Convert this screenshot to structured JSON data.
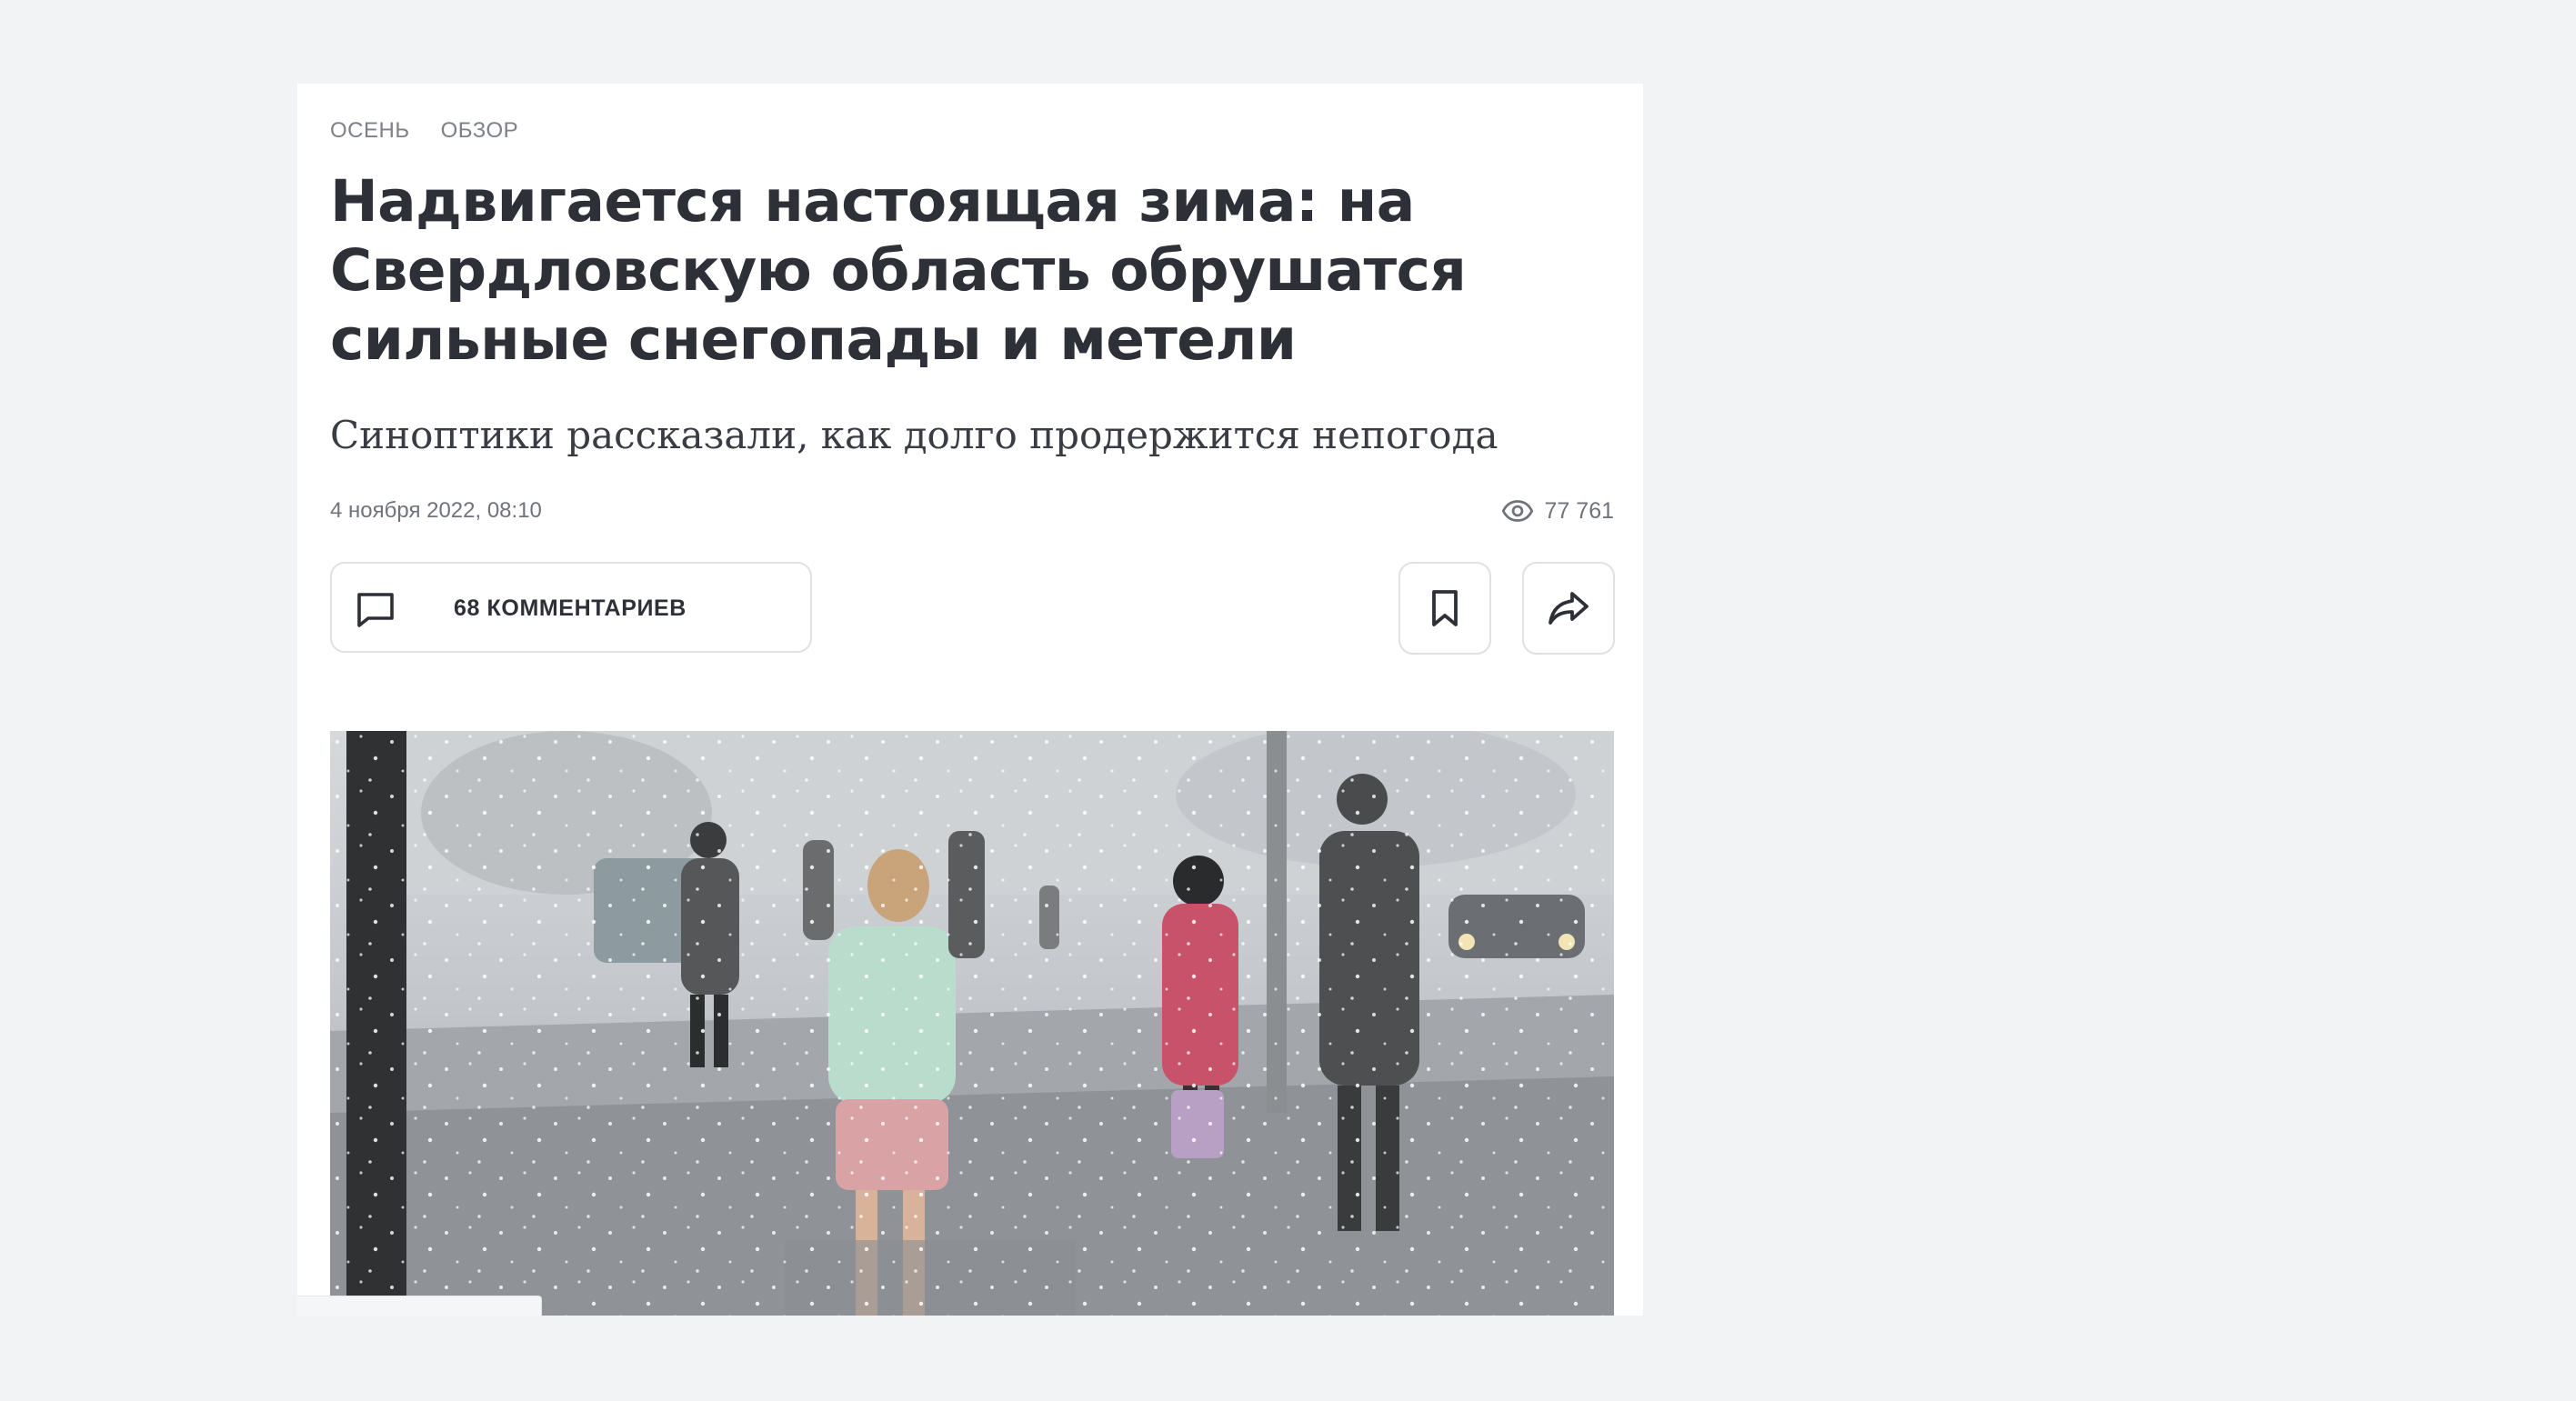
{
  "article": {
    "tags": [
      "ОСЕНЬ",
      "ОБЗОР"
    ],
    "title": "Надвигается настоящая зима: на Свердловскую область обрушатся сильные снегопады и метели",
    "subtitle": "Синоптики рассказали, как долго продержится непогода",
    "date": "4 ноября 2022, 08:10",
    "views": "77 761"
  },
  "actions": {
    "comments_label": "68 КОММЕНТАРИЕВ",
    "icons": {
      "comments": "comment-icon",
      "bookmark": "bookmark-icon",
      "share": "share-icon",
      "views": "eye-icon"
    }
  },
  "colors": {
    "background": "#f2f3f5",
    "card": "#ffffff",
    "text": "#2e3038",
    "muted": "#7c8089",
    "border": "#dfe1e5"
  }
}
